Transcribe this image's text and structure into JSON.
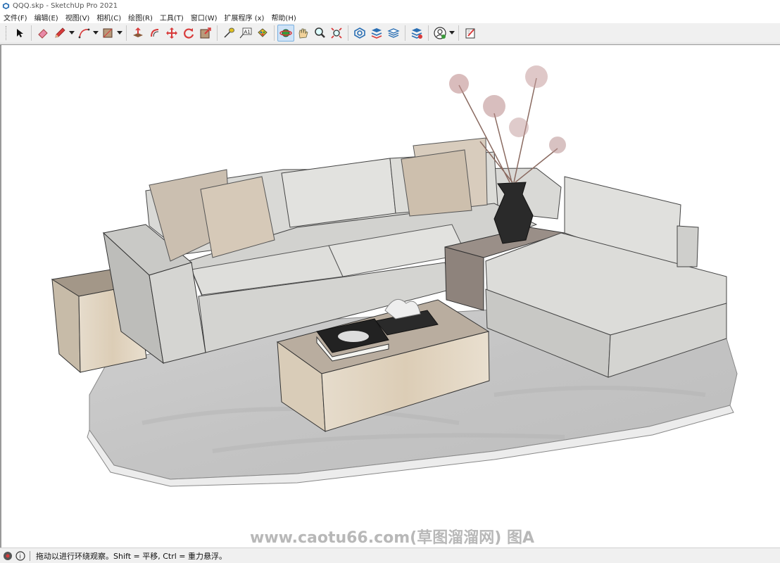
{
  "window": {
    "title": "QQQ.skp - SketchUp Pro 2021"
  },
  "menu": {
    "items": [
      "文件(F)",
      "编辑(E)",
      "视图(V)",
      "相机(C)",
      "绘图(R)",
      "工具(T)",
      "窗口(W)",
      "扩展程序 (x)",
      "帮助(H)"
    ]
  },
  "toolbar": {
    "tools": [
      "select-tool",
      "eraser-tool",
      "pencil-tool",
      "arc-tool",
      "rectangle-tool",
      "push-pull-tool",
      "offset-tool",
      "move-tool",
      "rotate-tool",
      "scale-tool",
      "tape-measure-tool",
      "text-tool",
      "paint-bucket-tool",
      "orbit-tool",
      "pan-tool",
      "zoom-tool",
      "zoom-extents-tool",
      "warehouse-tool",
      "extension-warehouse-tool",
      "layout-tool",
      "extension-manager-tool",
      "account-tool",
      "sketch-tool"
    ],
    "text_tool_label": "A1"
  },
  "viewport": {
    "watermark": "www.caotu66.com(草图溜溜网) 图A"
  },
  "status": {
    "text": "拖动以进行环绕观察。Shift = 平移, Ctrl = 重力悬浮。"
  },
  "colors": {
    "toolbar_bg": "#f0f0f0",
    "accent_active": "#cfe3f7",
    "icon_red": "#d83a3a",
    "icon_blue": "#2a6fb4"
  }
}
